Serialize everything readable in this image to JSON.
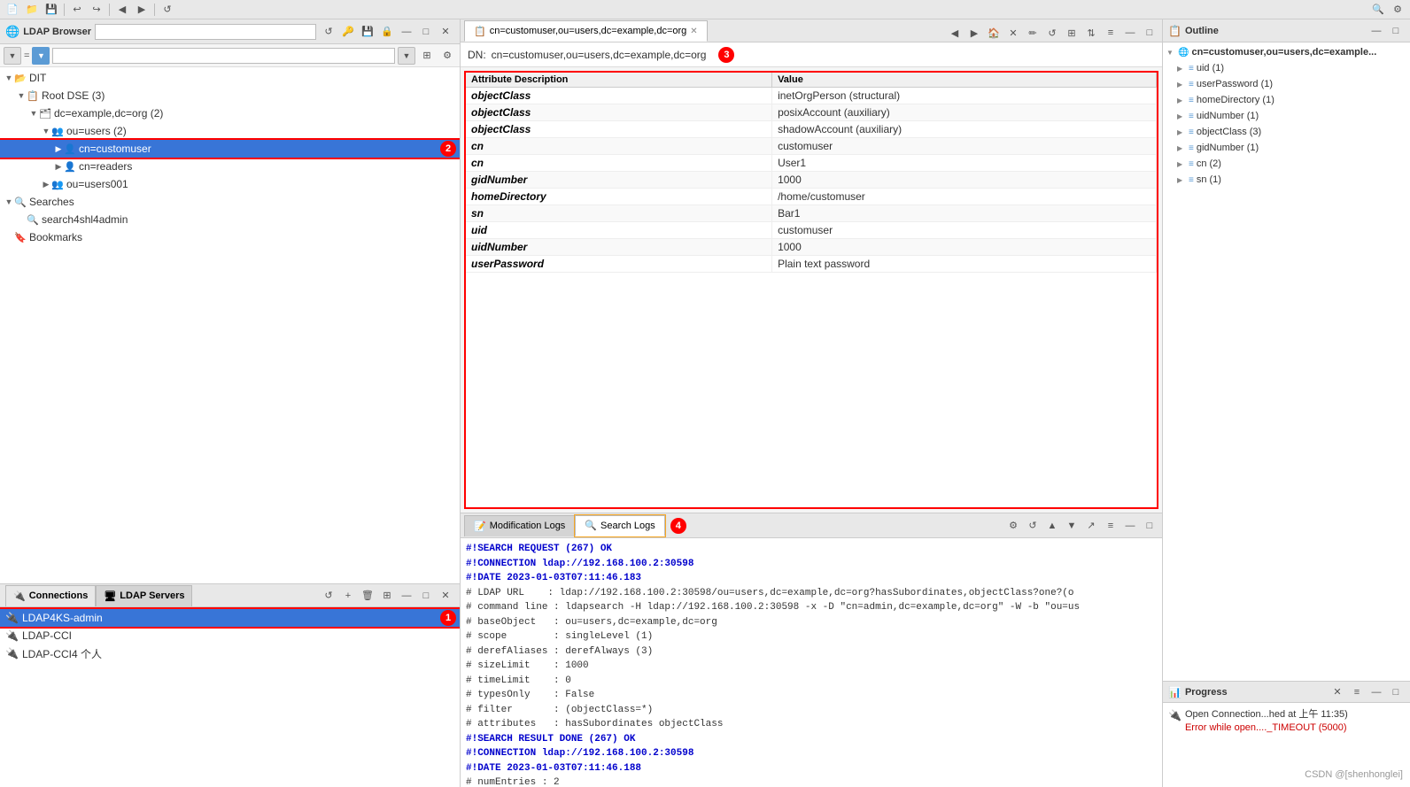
{
  "topToolbar": {
    "icons": [
      "new",
      "open",
      "save",
      "undo",
      "redo",
      "back",
      "forward"
    ]
  },
  "ldapBrowser": {
    "title": "LDAP Browser",
    "searchPlaceholder": ""
  },
  "tree": {
    "items": [
      {
        "id": "dit",
        "label": "DIT",
        "level": 0,
        "expanded": true,
        "type": "folder"
      },
      {
        "id": "root-dse",
        "label": "Root DSE (3)",
        "level": 1,
        "expanded": true,
        "type": "root"
      },
      {
        "id": "dc-example",
        "label": "dc=example,dc=org (2)",
        "level": 2,
        "expanded": true,
        "type": "dc"
      },
      {
        "id": "ou-users",
        "label": "ou=users (2)",
        "level": 3,
        "expanded": true,
        "type": "ou"
      },
      {
        "id": "cn-customuser",
        "label": "cn=customuser",
        "level": 4,
        "expanded": false,
        "type": "cn",
        "selected": true,
        "annotationNum": "2"
      },
      {
        "id": "cn-readers",
        "label": "cn=readers",
        "level": 4,
        "expanded": false,
        "type": "cn"
      },
      {
        "id": "ou-users001",
        "label": "ou=users001",
        "level": 3,
        "expanded": false,
        "type": "ou"
      },
      {
        "id": "searches",
        "label": "Searches",
        "level": 0,
        "expanded": true,
        "type": "search-folder"
      },
      {
        "id": "search4shl4admin",
        "label": "search4shl4admin",
        "level": 1,
        "type": "search"
      },
      {
        "id": "bookmarks",
        "label": "Bookmarks",
        "level": 0,
        "type": "bookmark-folder"
      }
    ]
  },
  "connections": {
    "tabs": [
      {
        "id": "connections",
        "label": "Connections",
        "active": true
      },
      {
        "id": "ldap-servers",
        "label": "LDAP Servers",
        "active": false
      }
    ],
    "items": [
      {
        "id": "ldap4ks-admin",
        "label": "LDAP4KS-admin",
        "selected": true,
        "annotationNum": "1"
      },
      {
        "id": "ldap-cci",
        "label": "LDAP-CCI"
      },
      {
        "id": "ldap-cci4",
        "label": "LDAP-CCI4 个人"
      }
    ]
  },
  "centerTab": {
    "label": "cn=customuser,ou=users,dc=example,dc=org",
    "closeLabel": "✕"
  },
  "dn": {
    "label": "DN:",
    "value": "cn=customuser,ou=users,dc=example,dc=org",
    "annotationNum": "3"
  },
  "attrTable": {
    "headers": [
      "Attribute Description",
      "Value"
    ],
    "rows": [
      {
        "attr": "objectClass",
        "value": "inetOrgPerson (structural)"
      },
      {
        "attr": "objectClass",
        "value": "posixAccount (auxiliary)"
      },
      {
        "attr": "objectClass",
        "value": "shadowAccount (auxiliary)"
      },
      {
        "attr": "cn",
        "value": "customuser"
      },
      {
        "attr": "cn",
        "value": "User1"
      },
      {
        "attr": "gidNumber",
        "value": "1000"
      },
      {
        "attr": "homeDirectory",
        "value": "/home/customuser"
      },
      {
        "attr": "sn",
        "value": "Bar1"
      },
      {
        "attr": "uid",
        "value": "customuser"
      },
      {
        "attr": "uidNumber",
        "value": "1000"
      },
      {
        "attr": "userPassword",
        "value": "Plain text password"
      }
    ]
  },
  "logPanel": {
    "tabs": [
      {
        "id": "modification-logs",
        "label": "Modification Logs",
        "active": false
      },
      {
        "id": "search-logs",
        "label": "Search Logs",
        "active": true
      }
    ],
    "annotationNum": "4",
    "logLines": [
      {
        "type": "header",
        "text": "#!SEARCH REQUEST (267) OK"
      },
      {
        "type": "header",
        "text": "#!CONNECTION ldap://192.168.100.2:30598"
      },
      {
        "type": "header",
        "text": "#!DATE 2023-01-03T07:11:46.183"
      },
      {
        "type": "comment",
        "text": "# LDAP URL    : ldap://192.168.100.2:30598/ou=users,dc=example,dc=org?hasSubordinates,objectClass?one?(o"
      },
      {
        "type": "comment",
        "text": "# command line : ldapsearch -H ldap://192.168.100.2:30598 -x -D \"cn=admin,dc=example,dc=org\" -W -b \"ou=us"
      },
      {
        "type": "comment",
        "text": "# baseObject   : ou=users,dc=example,dc=org"
      },
      {
        "type": "comment",
        "text": "# scope        : singleLevel (1)"
      },
      {
        "type": "comment",
        "text": "# derefAliases : derefAlways (3)"
      },
      {
        "type": "comment",
        "text": "# sizeLimit    : 1000"
      },
      {
        "type": "comment",
        "text": "# timeLimit    : 0"
      },
      {
        "type": "comment",
        "text": "# typesOnly    : False"
      },
      {
        "type": "comment",
        "text": "# filter       : (objectClass=*)"
      },
      {
        "type": "comment",
        "text": "# attributes   : hasSubordinates objectClass"
      },
      {
        "type": "blank",
        "text": ""
      },
      {
        "type": "header",
        "text": "#!SEARCH RESULT DONE (267) OK"
      },
      {
        "type": "header",
        "text": "#!CONNECTION ldap://192.168.100.2:30598"
      },
      {
        "type": "header",
        "text": "#!DATE 2023-01-03T07:11:46.188"
      },
      {
        "type": "comment",
        "text": "# numEntries : 2"
      }
    ]
  },
  "outline": {
    "title": "Outline",
    "rootLabel": "cn=customuser,ou=users,dc=example...",
    "items": [
      {
        "label": "cn=customuser,ou=users,dc=example...",
        "level": 0,
        "expanded": true
      },
      {
        "label": "uid (1)",
        "level": 1,
        "icon": "≡"
      },
      {
        "label": "userPassword (1)",
        "level": 1,
        "icon": "≡"
      },
      {
        "label": "homeDirectory (1)",
        "level": 1,
        "icon": "≡"
      },
      {
        "label": "uidNumber (1)",
        "level": 1,
        "icon": "≡"
      },
      {
        "label": "objectClass (3)",
        "level": 1,
        "icon": "≡"
      },
      {
        "label": "gidNumber (1)",
        "level": 1,
        "icon": "≡"
      },
      {
        "label": "cn (2)",
        "level": 1,
        "icon": "≡"
      },
      {
        "label": "sn (1)",
        "level": 1,
        "icon": "≡"
      }
    ]
  },
  "progress": {
    "title": "Progress",
    "items": [
      {
        "line1": "Open Connection...hed at 上午 11:35)",
        "line2": "Error while open...._TIMEOUT (5000)"
      }
    ]
  },
  "watermark": "CSDN @[shenhonglei]"
}
